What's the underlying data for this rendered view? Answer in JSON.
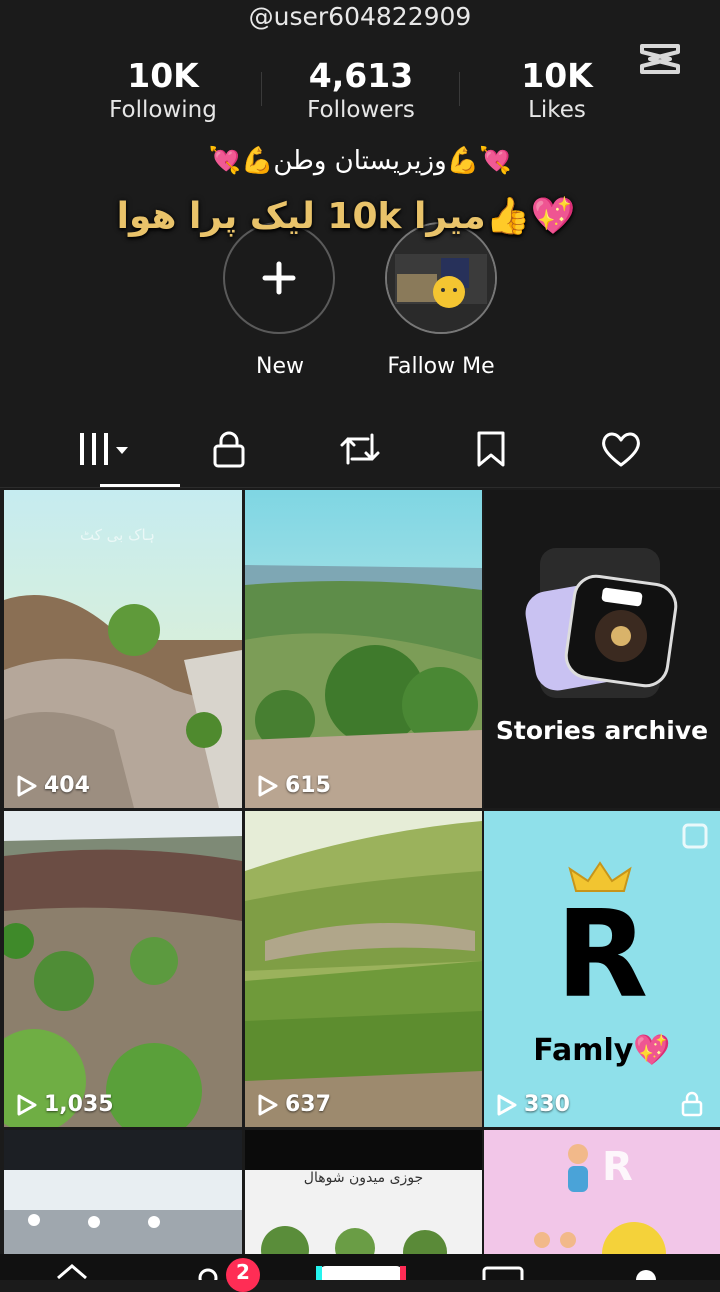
{
  "profile": {
    "username": "@user604822909",
    "stats": {
      "following": {
        "value": "10K",
        "label": "Following"
      },
      "followers": {
        "value": "4,613",
        "label": "Followers"
      },
      "likes": {
        "value": "10K",
        "label": "Likes"
      }
    },
    "bio": "💘💪وزیریستان وطن💪💘",
    "overlay_text": "💖👍میرا 10k لیک پرا ھوا"
  },
  "highlights": [
    {
      "label": "New"
    },
    {
      "label": "Fallow Me"
    }
  ],
  "tabs": [
    "videos",
    "private",
    "reposts",
    "favorites",
    "liked"
  ],
  "grid": {
    "views": [
      "404",
      "615",
      "1,035",
      "637",
      "330"
    ],
    "stories_archive_label": "Stories archive",
    "watermark_1": "ہاک بی کٹ",
    "r_tile_letter": "R",
    "r_tile_word": "Famly💖",
    "bottom_tile_text": "جوزی میدون شوھال",
    "pink_tile_letter": "R"
  },
  "nav": {
    "badge": "2"
  },
  "colors": {
    "background": "#1b1b1b",
    "badge": "#ff2d55",
    "overlay_text": "#e9c36a"
  }
}
